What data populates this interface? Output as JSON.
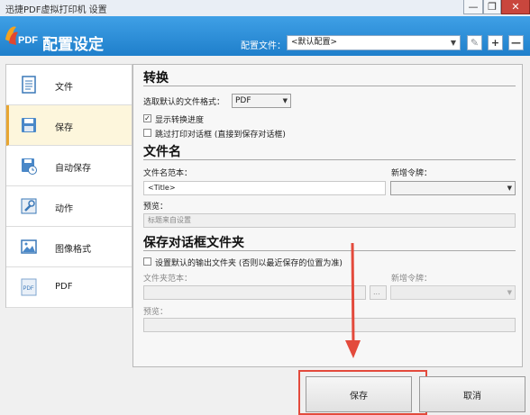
{
  "window": {
    "title": "迅捷PDF虚拟打印机 设置",
    "min_glyph": "—",
    "max_glyph": "❐",
    "close_glyph": "✕"
  },
  "header": {
    "logo_text": "PDF",
    "title": "配置设定",
    "config_label": "配置文件：",
    "config_value": "<默认配置>",
    "add_glyph": "+",
    "remove_glyph": "—",
    "edit_glyph": "✎"
  },
  "sidebar": {
    "items": [
      {
        "label": "文件",
        "icon": "document-icon"
      },
      {
        "label": "保存",
        "icon": "save-icon"
      },
      {
        "label": "自动保存",
        "icon": "auto-save-icon"
      },
      {
        "label": "动作",
        "icon": "wrench-icon"
      },
      {
        "label": "图像格式",
        "icon": "image-icon"
      },
      {
        "label": "PDF",
        "icon": "pdf-file-icon"
      }
    ],
    "active_index": 1,
    "pdf_icon_text": "PDF"
  },
  "convert": {
    "title": "转换",
    "format_label": "选取默认的文件格式：",
    "format_value": "PDF",
    "show_progress": {
      "label": "显示转换进度",
      "checked": true,
      "mark": "✓"
    },
    "skip_dialog": {
      "label": "跳过打印对话框 (直接到保存对话框)",
      "checked": false
    }
  },
  "filename": {
    "title": "文件名",
    "template_label": "文件名范本：",
    "template_value": "<Title>",
    "token_label": "新增令牌：",
    "preview_label": "预览：",
    "preview_value": "标题来自设置"
  },
  "folder": {
    "title": "保存对话框文件夹",
    "default_folder": {
      "label": "设置默认的输出文件夹 (否则以最近保存的位置为准)",
      "checked": false
    },
    "template_label": "文件夹范本：",
    "browse_label": "...",
    "token_label": "新增令牌：",
    "preview_label": "预览："
  },
  "buttons": {
    "save": "保存",
    "cancel": "取消"
  },
  "colors": {
    "header": "#2a8ed9",
    "annotation": "#e34a3c",
    "active_item": "#fdf6dc"
  }
}
